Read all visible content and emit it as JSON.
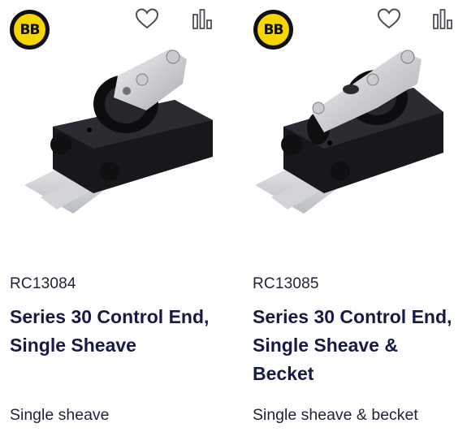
{
  "products": [
    {
      "logo_text": "BB",
      "favorite_icon": "heart-icon",
      "compare_icon": "bar-chart-icon",
      "sku": "RC13084",
      "title_line1": "Series 30 Control End,",
      "title_line2": "Single Sheave",
      "title_line3": "",
      "description": "Single sheave"
    },
    {
      "logo_text": "BB",
      "favorite_icon": "heart-icon",
      "compare_icon": "bar-chart-icon",
      "sku": "RC13085",
      "title_line1": "Series 30 Control End,",
      "title_line2": "Single Sheave &",
      "title_line3": "Becket",
      "description": "Single sheave & becket"
    }
  ],
  "colors": {
    "logo_yellow": "#f6d500",
    "title_navy": "#161a46",
    "divider": "#d9dadd"
  }
}
